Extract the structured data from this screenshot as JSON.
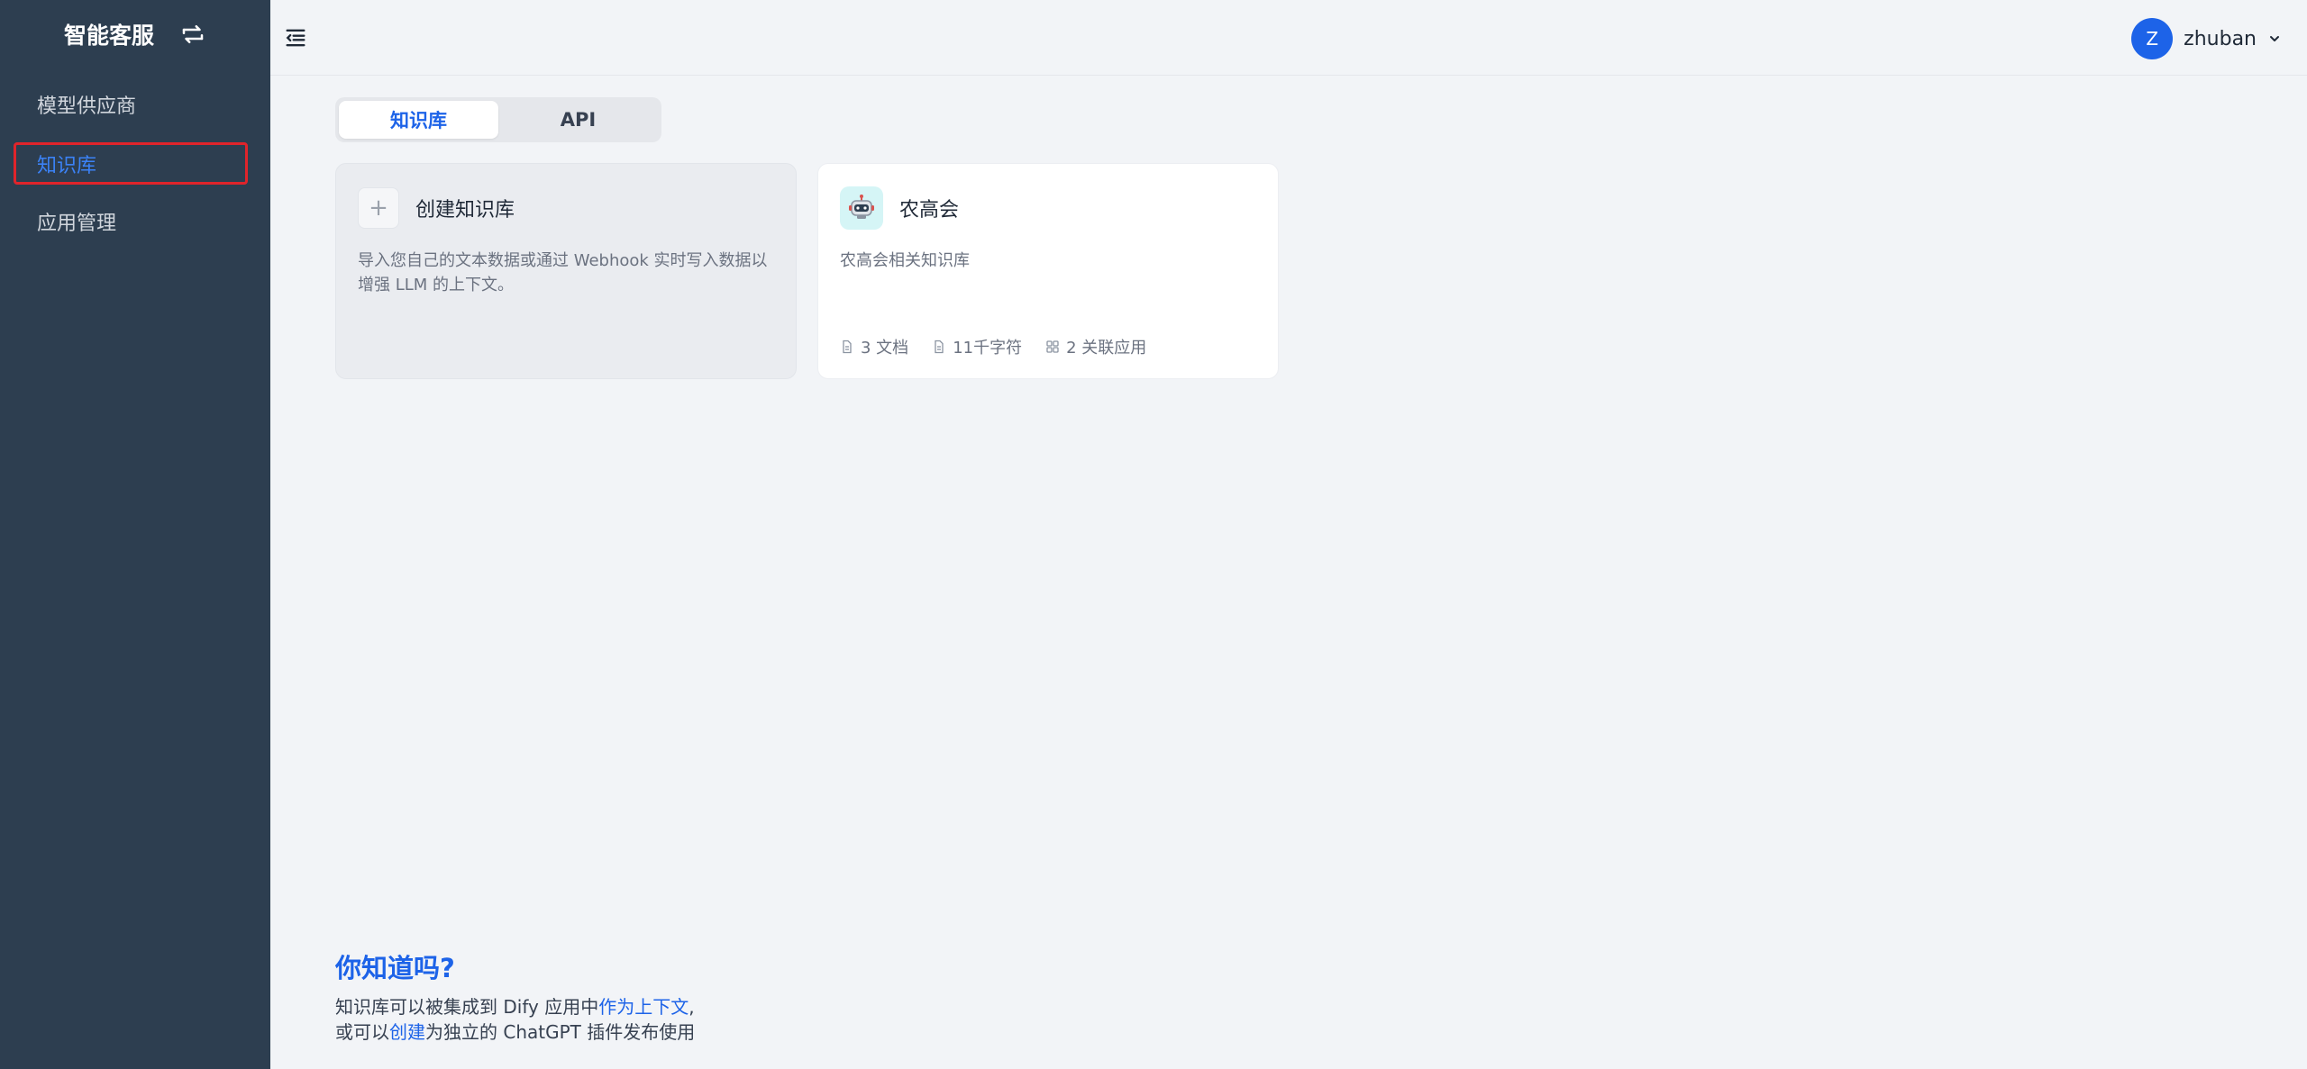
{
  "sidebar": {
    "brand": "智能客服",
    "items": [
      {
        "label": "模型供应商"
      },
      {
        "label": "知识库"
      },
      {
        "label": "应用管理"
      }
    ]
  },
  "header": {
    "avatar_letter": "Z",
    "username": "zhuban"
  },
  "tabs": [
    {
      "label": "知识库",
      "active": true
    },
    {
      "label": "API",
      "active": false
    }
  ],
  "create_card": {
    "title": "创建知识库",
    "description": "导入您自己的文本数据或通过 Webhook 实时写入数据以增强 LLM 的上下文。"
  },
  "kb_card": {
    "title": "农高会",
    "description": "农高会相关知识库",
    "stats": {
      "docs": "3 文档",
      "chars": "11千字符",
      "apps": "2 关联应用"
    }
  },
  "tips": {
    "title": "你知道吗?",
    "line1_prefix": "知识库可以被集成到 Dify 应用中",
    "line1_link": "作为上下文",
    "line1_suffix": ",",
    "line2_prefix": "或可以",
    "line2_link": "创建",
    "line2_suffix": "为独立的 ChatGPT 插件发布使用"
  },
  "colors": {
    "sidebar_bg": "#2d3e50",
    "accent": "#1d63e8",
    "page_bg": "#f2f4f7",
    "highlight_border": "#e0242b"
  }
}
